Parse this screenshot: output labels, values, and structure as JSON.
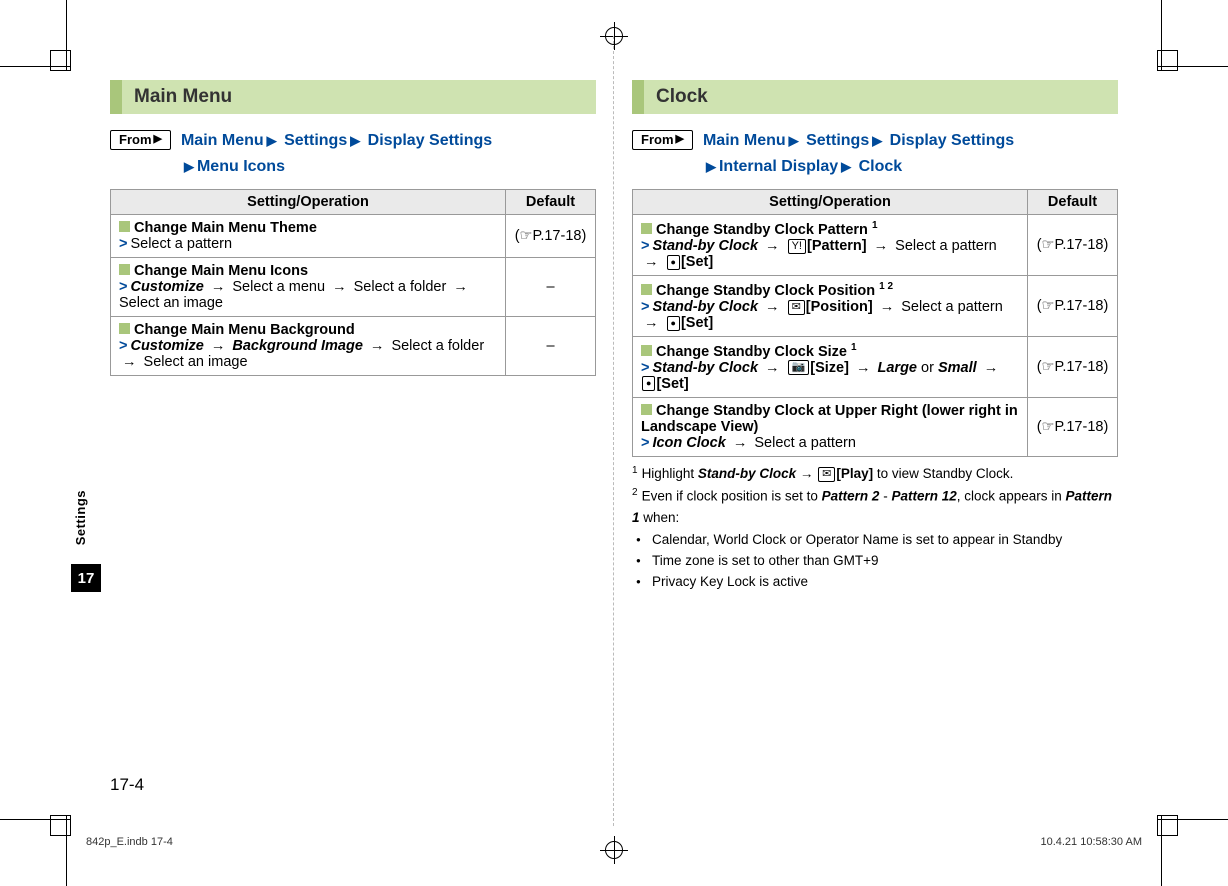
{
  "side_label": "Settings",
  "chapter_num": "17",
  "page_num": "17-4",
  "footer_left": "842p_E.indb   17-4",
  "footer_right": "10.4.21   10:58:30 AM",
  "left": {
    "heading": "Main Menu",
    "from_label": "From",
    "crumbs": [
      "Main Menu",
      "Settings",
      "Display Settings",
      "Menu Icons"
    ],
    "th_setting": "Setting/Operation",
    "th_default": "Default",
    "rows": [
      {
        "title": "Change Main Menu Theme",
        "step_html": "Select a pattern",
        "default": "(☞P.17-18)"
      },
      {
        "title": "Change Main Menu Icons",
        "step_html": "<span class='bi'>Customize</span> <span class='arr'>→</span> Select a menu <span class='arr'>→</span> Select a folder <span class='arr'>→</span> Select an image",
        "default": "–"
      },
      {
        "title": "Change Main Menu Background",
        "step_html": "<span class='bi'>Customize</span> <span class='arr'>→</span> <span class='bi'>Background Image</span> <span class='arr'>→</span> Select a folder <span class='arr'>→</span> Select an image",
        "default": "–"
      }
    ]
  },
  "right": {
    "heading": "Clock",
    "from_label": "From",
    "crumbs": [
      "Main Menu",
      "Settings",
      "Display Settings",
      "Internal Display",
      "Clock"
    ],
    "th_setting": "Setting/Operation",
    "th_default": "Default",
    "rows": [
      {
        "title_html": "Change Standby Clock Pattern <span class='sup'>1</span>",
        "step_html": "<span class='bi'>Stand-by Clock</span> <span class='arr'>→</span> <span class='key'>Y!</span><b>[Pattern]</b> <span class='arr'>→</span> Select a pattern <span class='arr'>→</span> <span class='key dot'></span><b>[Set]</b>",
        "default": "(☞P.17-18)"
      },
      {
        "title_html": "Change Standby Clock Position <span class='sup'>1 2</span>",
        "step_html": "<span class='bi'>Stand-by Clock</span> <span class='arr'>→</span> <span class='key'>✉</span><b>[Position]</b> <span class='arr'>→</span> Select a pattern <span class='arr'>→</span> <span class='key dot'></span><b>[Set]</b>",
        "default": "(☞P.17-18)"
      },
      {
        "title_html": "Change Standby Clock Size <span class='sup'>1</span>",
        "step_html": "<span class='bi'>Stand-by Clock</span> <span class='arr'>→</span> <span class='key'>📷</span><b>[Size]</b> <span class='arr'>→</span> <span class='bi'>Large</span> or <span class='bi'>Small</span> <span class='arr'>→</span> <span class='key dot'></span><b>[Set]</b>",
        "default": "(☞P.17-18)"
      },
      {
        "title_html": "Change Standby Clock at Upper Right (lower right in Landscape View)",
        "step_html": "<span class='bi'>Icon Clock</span> <span class='arr'>→</span> Select a pattern",
        "default": "(☞P.17-18)"
      }
    ],
    "footnote1_html": "Highlight <span class='bi'>Stand-by Clock</span> → <span class='key'>✉</span><b>[Play]</b> to view Standby Clock.",
    "footnote2_html": "Even if clock position is set to <span class='bi'>Pattern 2</span> - <span class='bi'>Pattern 12</span>, clock appears in <span class='bi'>Pattern 1</span> when:",
    "bullets": [
      "Calendar, World Clock or Operator Name is set to appear in Standby",
      "Time zone is set to other than GMT+9",
      "Privacy Key Lock is active"
    ]
  }
}
